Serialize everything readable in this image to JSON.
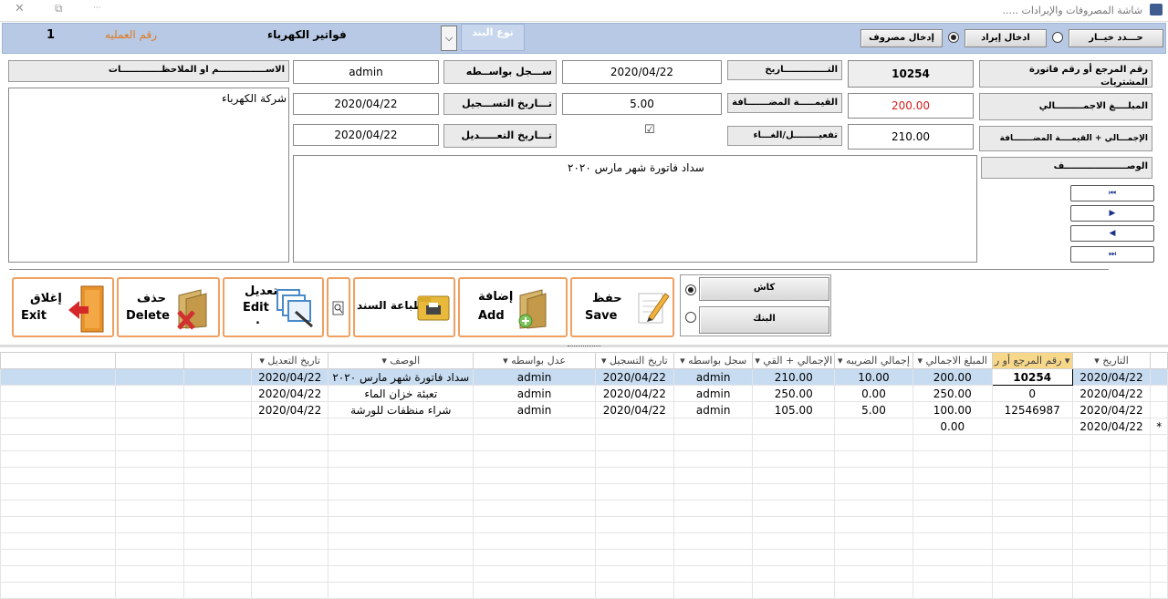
{
  "window": {
    "title": "شاشة المصروفات والإيرادات .....",
    "close_symbol": "✕",
    "restore_symbol": "⧉",
    "minimize_symbol": "···"
  },
  "header": {
    "operation_number": "1",
    "operation_number_label": "رقم العمليه",
    "bill_title": "فواتير الكهرباء",
    "item_type_label": "نوع البند",
    "choose_label": "حـــدد خيــار",
    "income_label": "ادخال إيراد",
    "expense_label": "إدخال مصروف"
  },
  "form": {
    "ref_label": "رقم المرجع أو رقم فاتورة المشتريات",
    "ref_value": "10254",
    "date_label": "التــــــــــــــاريخ",
    "date_value": "2020/04/22",
    "recorded_by_label": "ســـجل بواســطه",
    "recorded_by_value": "admin",
    "name_notes_label": "الاســـــــــــــــم او الملاحظـــــــــــــات",
    "total_label": "المبلــــغ الاجمـــــــــالي",
    "total_value": "200.00",
    "vat_label": "القيمـــــة المضـــــــافة",
    "vat_value": "5.00",
    "reg_date_label": "تـــاريخ التســـجيل",
    "reg_date_value": "2020/04/22",
    "notes_value": "شركة الكهرباء",
    "total_vat_label": "الإجمـــالي + القيمــــة المضـــــــافة",
    "total_vat_value": "210.00",
    "activate_label": "تفعيــــــــل/الغـــاء",
    "activate_check": "☑",
    "edit_date_label": "تـــاريخ التعـــــديل",
    "edit_date_value": "2020/04/22",
    "desc_label": "الوصــــــــــــــــــــف",
    "desc_value": "سداد فاتورة شهر مارس ٢٠٢٠"
  },
  "nav": {
    "first": "⏮",
    "next": "▶",
    "prev": "◀",
    "last": "⏭"
  },
  "payment": {
    "cash": "كاش",
    "bank": "البنك"
  },
  "actions": {
    "save_ar": "حفظ",
    "save_en": "Save",
    "add_ar": "إضافة",
    "add_en": "Add",
    "print_ar": "طباعة السند",
    "edit_ar": "تعديل",
    "edit_en": "Edit",
    "edit_dot": ".",
    "delete_ar": "حذف",
    "delete_en": "Delete",
    "exit_ar": "إغلاق",
    "exit_en": "Exit"
  },
  "grid": {
    "columns": [
      "التاريخ",
      "رقم المرجع أو ر",
      "المبلغ الاجمالي",
      "إجمالي الضريبه",
      "الإجمالي + القي",
      "سجل بواسطه",
      "تاريخ التسجيل",
      "عدل بواسطه",
      "الوصف",
      "تاريخ التعديل"
    ],
    "rows": [
      [
        "2020/04/22",
        "10254",
        "200.00",
        "10.00",
        "210.00",
        "admin",
        "2020/04/22",
        "admin",
        "سداد فاتورة شهر مارس ٢٠٢٠",
        "2020/04/22"
      ],
      [
        "2020/04/22",
        "0",
        "250.00",
        "0.00",
        "250.00",
        "admin",
        "2020/04/22",
        "admin",
        "تعبئة خزان الماء",
        "2020/04/22"
      ],
      [
        "2020/04/22",
        "12546987",
        "100.00",
        "5.00",
        "105.00",
        "admin",
        "2020/04/22",
        "admin",
        "شراء منظفات للورشة",
        "2020/04/22"
      ]
    ],
    "new_row": {
      "date": "2020/04/22",
      "total": "0.00",
      "marker": "*"
    }
  }
}
